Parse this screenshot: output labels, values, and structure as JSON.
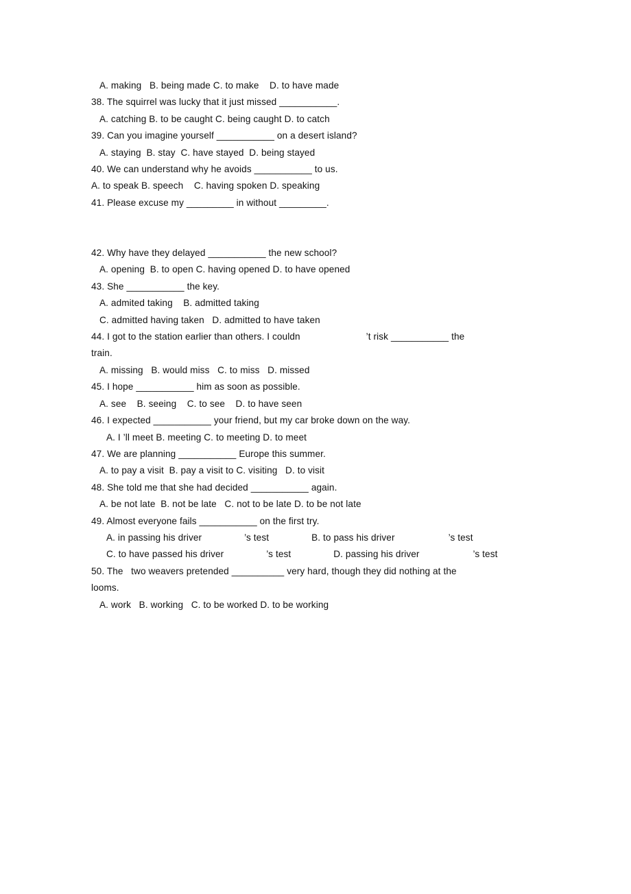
{
  "document": {
    "page_background": "#ffffff",
    "text_color": "#111111",
    "lines": [
      {
        "id": "q37-options",
        "indent": 1,
        "text": "A. making   B. being made C. to make    D. to have made"
      },
      {
        "id": "q38-stem",
        "indent": 0,
        "text": "38. The squirrel was lucky that it just missed ___________."
      },
      {
        "id": "q38-options",
        "indent": 1,
        "text": "A. catching B. to be caught C. being caught D. to catch"
      },
      {
        "id": "q39-stem",
        "indent": 0,
        "text": "39. Can you imagine yourself ___________ on a desert island?"
      },
      {
        "id": "q39-options",
        "indent": 1,
        "text": "A. staying  B. stay  C. have stayed  D. being stayed"
      },
      {
        "id": "q40-stem",
        "indent": 0,
        "text": "40. We can understand why he avoids ___________ to us."
      },
      {
        "id": "q40-options",
        "indent": 0,
        "text": "A. to speak B. speech    C. having spoken D. speaking"
      },
      {
        "id": "q41-stem",
        "indent": 0,
        "text": "41. Please excuse my _________ in without _________."
      },
      {
        "id": "spacer-1",
        "indent": 0,
        "text": ""
      },
      {
        "id": "spacer-2",
        "indent": 0,
        "text": ""
      },
      {
        "id": "q42-stem",
        "indent": 0,
        "text": "42. Why have they delayed ___________ the new school?"
      },
      {
        "id": "q42-options",
        "indent": 1,
        "text": "A. opening  B. to open C. having opened D. to have opened"
      },
      {
        "id": "q43-stem",
        "indent": 0,
        "text": "43. She ___________ the key."
      },
      {
        "id": "q43-options-ab",
        "indent": 1,
        "text": "A. admited taking    B. admitted taking"
      },
      {
        "id": "q43-options-cd",
        "indent": 1,
        "text": "C. admitted having taken   D. admitted to have taken"
      },
      {
        "id": "q44-stem-part1",
        "indent": 0,
        "text": "44. I got to the station earlier than others. I couldn"
      },
      {
        "id": "q44-stem-part2",
        "indent": 0,
        "text": "’t risk ___________ the"
      },
      {
        "id": "q44-stem-cont",
        "indent": 0,
        "text": "train."
      },
      {
        "id": "q44-options",
        "indent": 1,
        "text": "A. missing   B. would miss   C. to miss   D. missed"
      },
      {
        "id": "q45-stem",
        "indent": 0,
        "text": "45. I hope ___________ him as soon as possible."
      },
      {
        "id": "q45-options",
        "indent": 1,
        "text": "A. see    B. seeing    C. to see    D. to have seen"
      },
      {
        "id": "q46-stem",
        "indent": 0,
        "text": "46. I expected ___________ your friend, but my car broke down on the way."
      },
      {
        "id": "q46-options",
        "indent": 2,
        "text": "A. I ’ll meet B. meeting C. to meeting D. to meet"
      },
      {
        "id": "q47-stem",
        "indent": 0,
        "text": "47. We are planning ___________ Europe this summer."
      },
      {
        "id": "q47-options",
        "indent": 1,
        "text": "A. to pay a visit  B. pay a visit to C. visiting   D. to visit"
      },
      {
        "id": "q48-stem",
        "indent": 0,
        "text": "48. She told me that she had decided ___________ again."
      },
      {
        "id": "q48-options",
        "indent": 1,
        "text": "A. be not late  B. not be late   C. not to be late D. to be not late"
      },
      {
        "id": "q49-stem",
        "indent": 0,
        "text": "49. Almost everyone fails ___________ on the first try."
      },
      {
        "id": "q49-options-ab",
        "indent": 2,
        "text": "A. in passing his driver"
      },
      {
        "id": "q49-options-cd",
        "indent": 2,
        "text": "C. to have passed his driver"
      },
      {
        "id": "q50-stem",
        "indent": 0,
        "text": "50. The   two weavers pretended __________ very hard, though they did nothing at the"
      },
      {
        "id": "q50-stem-cont",
        "indent": 0,
        "text": "looms."
      },
      {
        "id": "q50-options",
        "indent": 1,
        "text": "A. work   B. working   C. to be worked D. to be working"
      }
    ],
    "q44": {
      "part1": "44. I got to the station earlier than others. I couldn",
      "part2": "’t risk ___________ the",
      "continuation": "train."
    },
    "q49": {
      "option_a_stem": "A. in passing his driver",
      "option_a_tail": "’s test",
      "option_b_stem": "B. to pass his driver",
      "option_b_tail": "’s test",
      "option_c_stem": "C. to have passed his driver",
      "option_c_tail": "’s test",
      "option_d_stem": "D. passing his driver",
      "option_d_tail": "’s test"
    }
  }
}
